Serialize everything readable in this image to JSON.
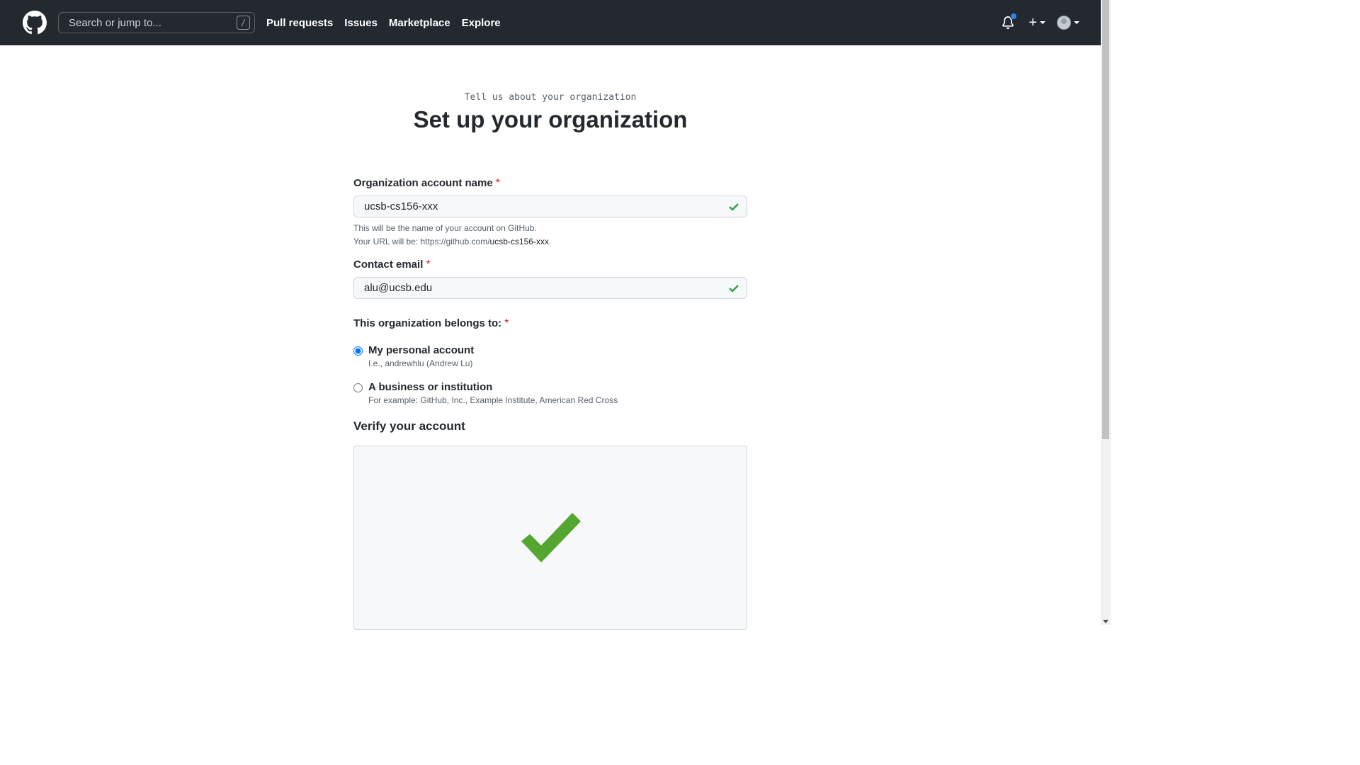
{
  "header": {
    "search_placeholder": "Search or jump to...",
    "search_shortcut": "/",
    "nav": [
      "Pull requests",
      "Issues",
      "Marketplace",
      "Explore"
    ],
    "plus_label": "+"
  },
  "page": {
    "subtitle": "Tell us about your organization",
    "title": "Set up your organization"
  },
  "form": {
    "org_name": {
      "label": "Organization account name",
      "required": "*",
      "value": "ucsb-cs156-xxx",
      "note_line1": "This will be the name of your account on GitHub.",
      "note_line2_prefix": "Your URL will be: https://github.com/",
      "note_line2_name": "ucsb-cs156-xxx",
      "note_line2_suffix": "."
    },
    "contact_email": {
      "label": "Contact email",
      "required": "*",
      "value": "alu@ucsb.edu"
    },
    "belongs_to": {
      "label": "This organization belongs to:",
      "required": "*",
      "options": [
        {
          "title": "My personal account",
          "desc": "I.e., andrewhlu (Andrew Lu)",
          "checked": true
        },
        {
          "title": "A business or institution",
          "desc": "For example: GitHub, Inc., Example Institute, American Red Cross",
          "checked": false
        }
      ]
    },
    "verify": {
      "title": "Verify your account"
    }
  },
  "colors": {
    "header_bg": "#24292f",
    "success_green": "#2da44e",
    "big_check_green": "#55a630",
    "notification_dot": "#2f81f7",
    "required_red": "#cf222e"
  }
}
